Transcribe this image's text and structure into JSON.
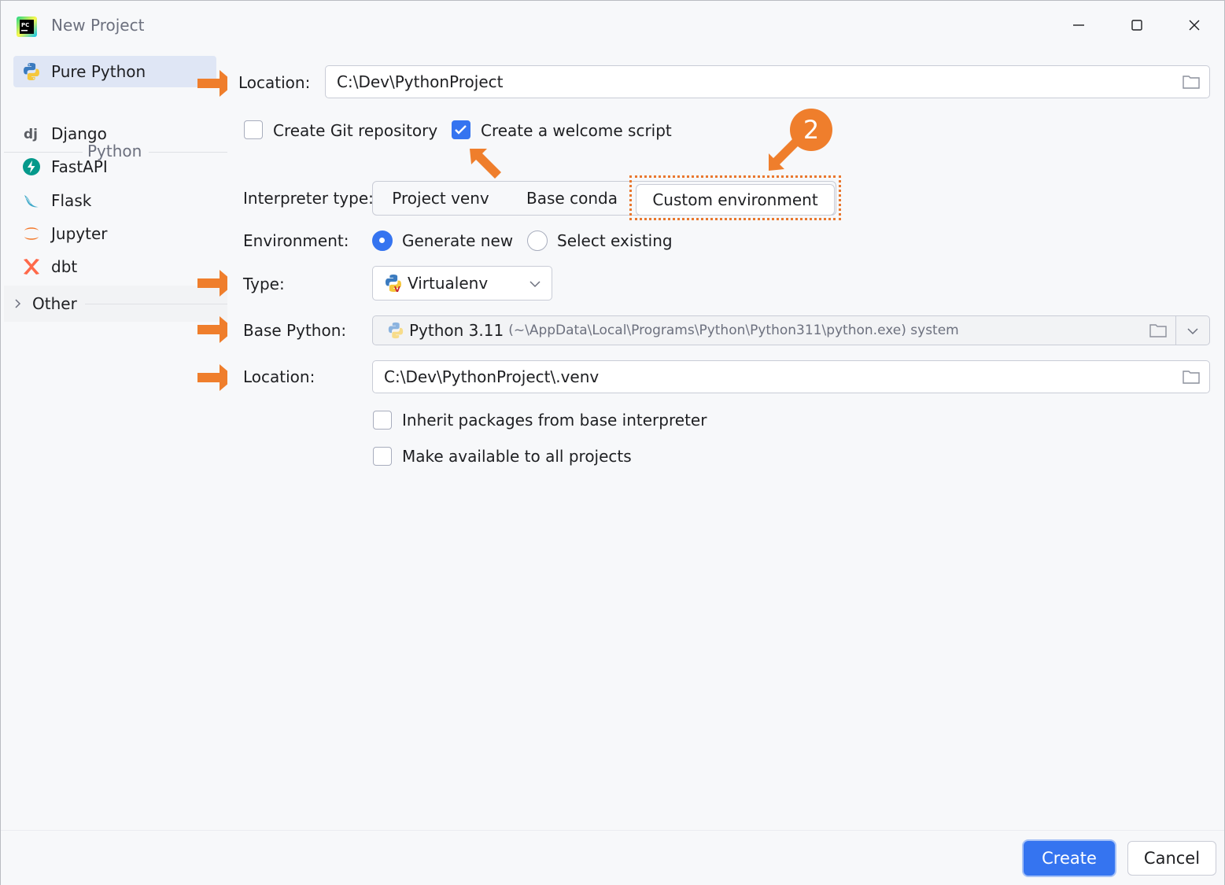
{
  "window": {
    "title": "New Project"
  },
  "sidebar": {
    "items": [
      {
        "label": "Pure Python",
        "icon": "python-icon",
        "selected": true
      },
      {
        "label": "Django",
        "icon": "django-icon"
      },
      {
        "label": "FastAPI",
        "icon": "fastapi-icon"
      },
      {
        "label": "Flask",
        "icon": "flask-icon"
      },
      {
        "label": "Jupyter",
        "icon": "jupyter-icon"
      },
      {
        "label": "dbt",
        "icon": "dbt-icon"
      }
    ],
    "section_header": "Python",
    "other_label": "Other"
  },
  "form": {
    "location_label": "Location:",
    "location_value": "C:\\Dev\\PythonProject",
    "create_git_label": "Create Git repository",
    "create_git_checked": false,
    "welcome_script_label": "Create a welcome script",
    "welcome_script_checked": true,
    "interpreter_type_label": "Interpreter type:",
    "interpreter_options": [
      "Project venv",
      "Base conda",
      "Custom environment"
    ],
    "interpreter_selected": "Custom environment",
    "environment_label": "Environment:",
    "env_generate_label": "Generate new",
    "env_select_label": "Select existing",
    "env_selected": "Generate new",
    "type_label": "Type:",
    "type_value": "Virtualenv",
    "base_python_label": "Base Python:",
    "base_python_value": "Python 3.11",
    "base_python_path": "(~\\AppData\\Local\\Programs\\Python\\Python311\\python.exe) system",
    "venv_location_label": "Location:",
    "venv_location_value": "C:\\Dev\\PythonProject\\.venv",
    "inherit_label": "Inherit packages from base interpreter",
    "inherit_checked": false,
    "available_all_label": "Make available to all projects",
    "available_all_checked": false
  },
  "annotation": {
    "badge_number": "2",
    "accent_color": "#ef7e2c"
  },
  "footer": {
    "create_label": "Create",
    "cancel_label": "Cancel"
  },
  "colors": {
    "accent": "#3574f0",
    "annotation": "#ef7e2c"
  }
}
